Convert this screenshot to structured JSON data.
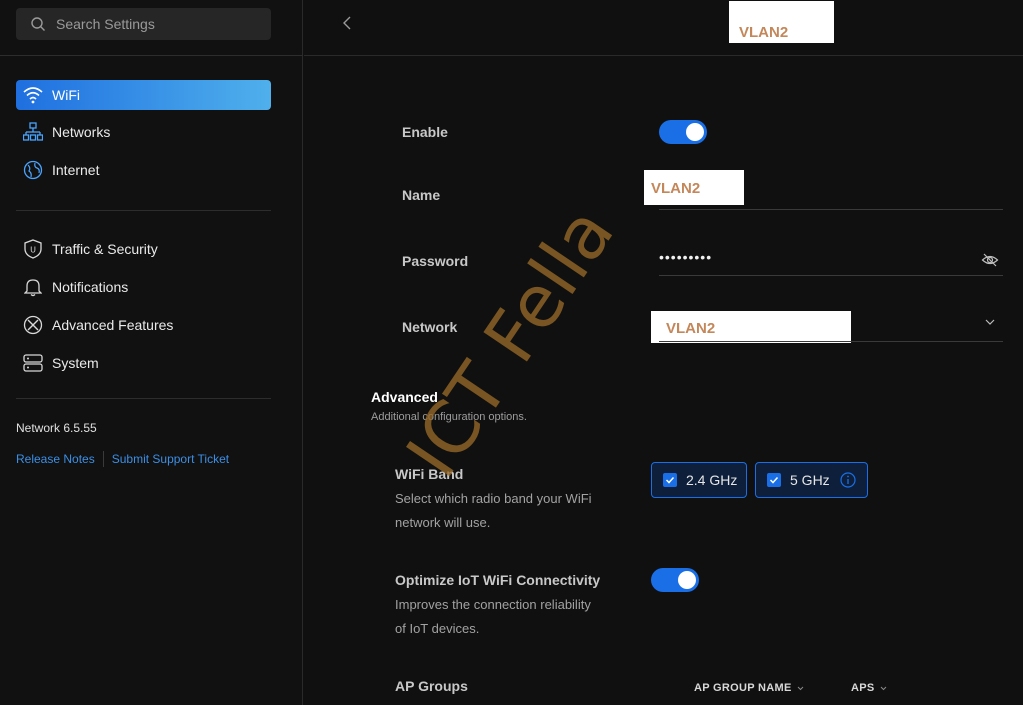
{
  "search": {
    "placeholder": "Search Settings"
  },
  "sidebar": {
    "items": [
      {
        "label": "WiFi",
        "icon": "wifi-icon",
        "active": true
      },
      {
        "label": "Networks",
        "icon": "network-topology-icon"
      },
      {
        "label": "Internet",
        "icon": "globe-icon"
      },
      {
        "label": "Traffic & Security",
        "icon": "shield-icon"
      },
      {
        "label": "Notifications",
        "icon": "bell-icon"
      },
      {
        "label": "Advanced Features",
        "icon": "tools-icon"
      },
      {
        "label": "System",
        "icon": "server-icon"
      }
    ],
    "version": "Network 6.5.55",
    "links": {
      "release_notes": "Release Notes",
      "support": "Submit Support Ticket"
    }
  },
  "header": {
    "title": "VLAN2",
    "back_icon": "chevron-left-icon"
  },
  "form": {
    "enable": {
      "label": "Enable",
      "on": true
    },
    "name": {
      "label": "Name",
      "value": "VLAN2"
    },
    "password": {
      "label": "Password",
      "value": "•••••••••",
      "icon": "eye-slash-icon"
    },
    "network": {
      "label": "Network",
      "value": "VLAN2",
      "icon": "chevron-down-icon"
    }
  },
  "advanced": {
    "title": "Advanced",
    "subtitle": "Additional configuration options.",
    "wifi_band": {
      "label": "WiFi Band",
      "desc_line1": "Select which radio band your WiFi",
      "desc_line2": "network will use.",
      "options": [
        {
          "label": "2.4 GHz",
          "checked": true
        },
        {
          "label": "5 GHz",
          "checked": true,
          "info_icon": "info-icon"
        }
      ]
    },
    "iot": {
      "label": "Optimize IoT WiFi Connectivity",
      "desc_line1": "Improves the connection reliability",
      "desc_line2": "of IoT devices.",
      "on": true
    },
    "ap_groups": {
      "label": "AP Groups",
      "columns": [
        "AP GROUP NAME",
        "APS"
      ]
    }
  },
  "watermark": "ICT Fella",
  "colors": {
    "accent": "#1a6fe6",
    "background": "#101010",
    "redaction_text": "#c4875a"
  }
}
